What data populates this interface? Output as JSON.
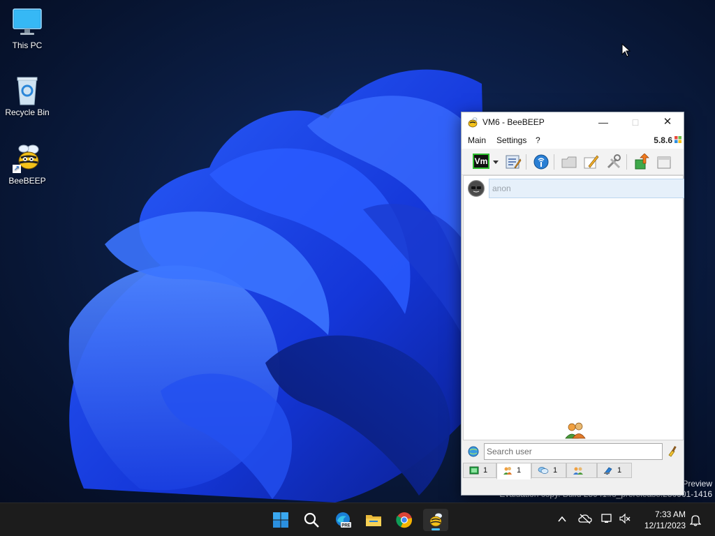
{
  "desktop": {
    "icons": [
      {
        "label": "This PC"
      },
      {
        "label": "Recycle Bin"
      },
      {
        "label": "BeeBEEP"
      }
    ],
    "watermark_line1": "Preview",
    "watermark_line2": "Evaluation copy. Build 25941.rs_prerelease.230901-1416"
  },
  "window": {
    "title": "VM6 - BeeBEEP",
    "menu": [
      "Main",
      "Settings",
      "?"
    ],
    "version": "5.8.6",
    "status_badge": "Vm",
    "toolbar_icons": [
      "status-selector-icon",
      "dropdown-arrow-icon",
      "edit-profile-icon",
      "network-icon",
      "folder-icon",
      "pencil-icon",
      "tools-icon",
      "update-icon",
      "window-icon"
    ],
    "users": [
      {
        "name": "anon"
      }
    ],
    "search": {
      "placeholder": "Search user",
      "value": ""
    },
    "tabs": [
      {
        "icon": "chat-screen-icon",
        "count": "1"
      },
      {
        "icon": "users-icon",
        "count": "1"
      },
      {
        "icon": "chat-bubble-icon",
        "count": "1"
      },
      {
        "icon": "groups-icon",
        "count": ""
      },
      {
        "icon": "file-share-icon",
        "count": "1"
      }
    ]
  },
  "taskbar": {
    "apps": [
      "start-icon",
      "search-icon",
      "edge-beta-icon",
      "file-explorer-icon",
      "chrome-icon",
      "beebeep-icon"
    ],
    "edge_badge": "PRE",
    "time": "7:33 AM",
    "date": "12/11/2023"
  },
  "colors": {
    "accent": "#4cc2ff",
    "taskbar": "#1c1c1c",
    "wallpaper_blue": "#1e4cff"
  }
}
